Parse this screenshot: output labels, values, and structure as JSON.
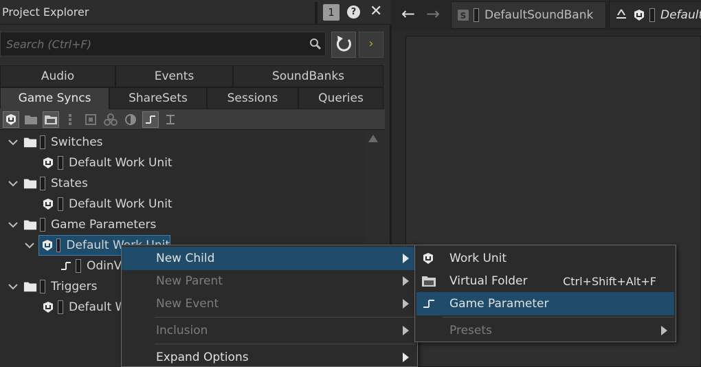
{
  "panel": {
    "title": "Project Explorer",
    "badge": "1",
    "search_placeholder": "Search (Ctrl+F)"
  },
  "tabs_row1": [
    "Audio",
    "Events",
    "SoundBanks"
  ],
  "tabs_row2": [
    "Game Syncs",
    "ShareSets",
    "Sessions",
    "Queries"
  ],
  "active_tab": "Game Syncs",
  "tree": {
    "switches": "Switches",
    "switches_wu": "Default Work Unit",
    "states": "States",
    "states_wu": "Default Work Unit",
    "game_params": "Game Parameters",
    "game_params_wu": "Default Work Unit",
    "odin": "OdinVo",
    "triggers": "Triggers",
    "triggers_wu": "Default Wo"
  },
  "doc_tabs": {
    "tab1": "DefaultSoundBank",
    "tab2": "Default"
  },
  "context_menu": {
    "new_child": "New Child",
    "new_parent": "New Parent",
    "new_event": "New Event",
    "inclusion": "Inclusion",
    "expand_options": "Expand Options"
  },
  "submenu": {
    "work_unit": "Work Unit",
    "virtual_folder": "Virtual Folder",
    "virtual_folder_shortcut": "Ctrl+Shift+Alt+F",
    "game_parameter": "Game Parameter",
    "presets": "Presets"
  },
  "colors": {
    "selection": "#204c6c",
    "accent_arrow": "#c89a3a"
  }
}
